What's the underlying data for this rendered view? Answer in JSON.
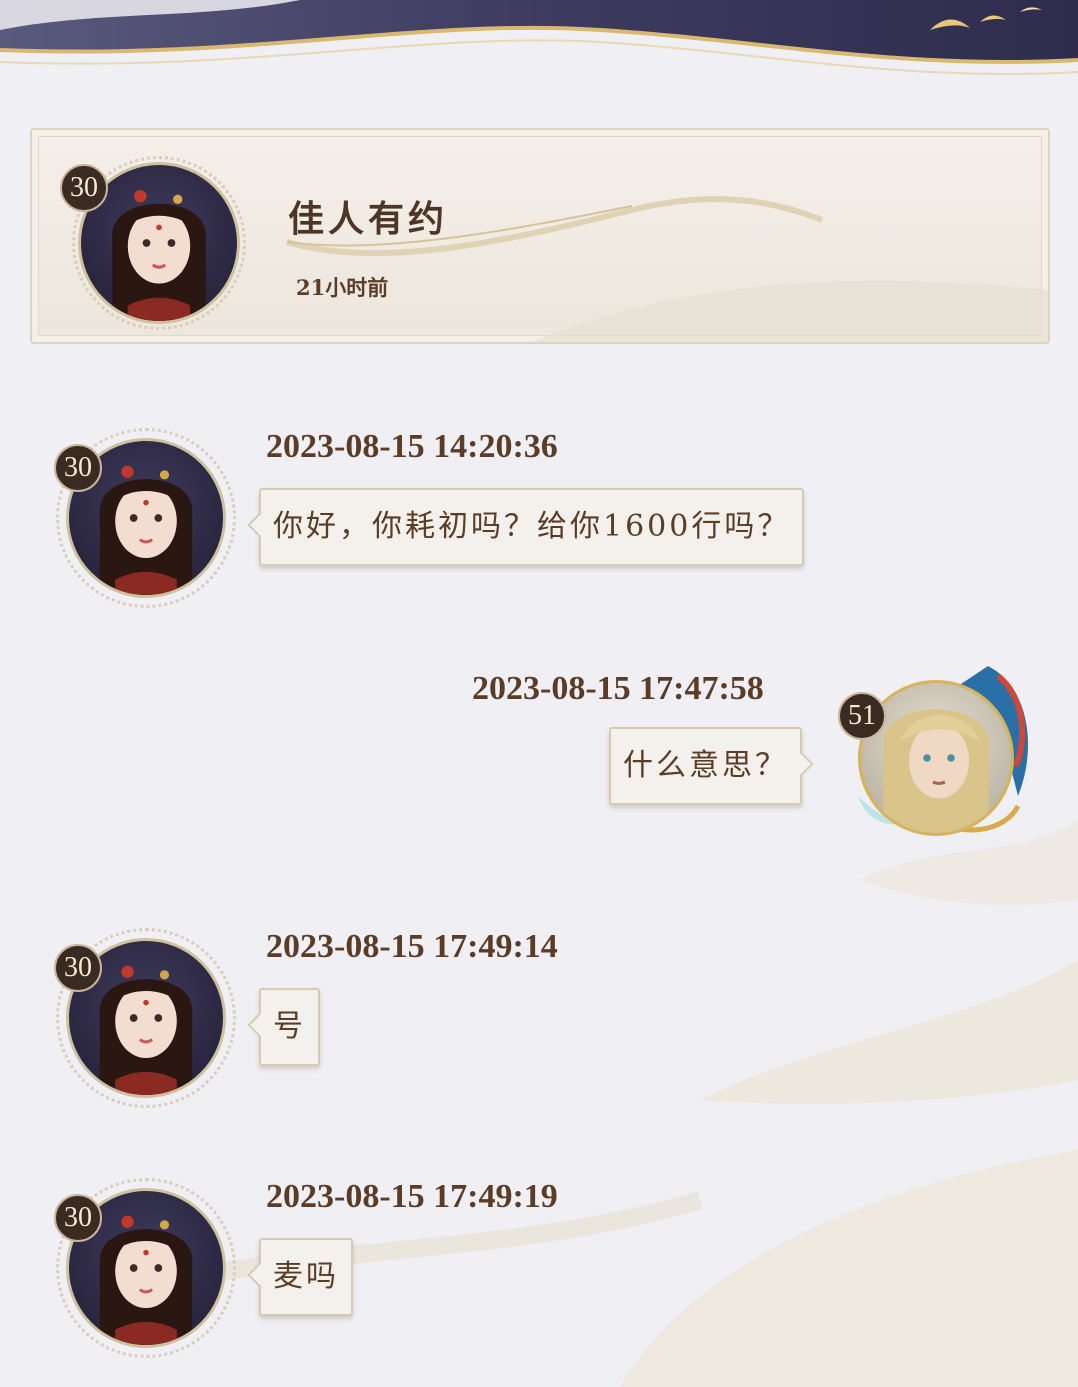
{
  "profile": {
    "name": "佳人有约",
    "last_active": "21小时前",
    "level": "30"
  },
  "messages": [
    {
      "side": "left",
      "level": "30",
      "timestamp": "2023-08-15 14:20:36",
      "text": "你好，你耗初吗？给你1600行吗？"
    },
    {
      "side": "right",
      "level": "51",
      "timestamp": "2023-08-15 17:47:58",
      "text": "什么意思？"
    },
    {
      "side": "left",
      "level": "30",
      "timestamp": "2023-08-15 17:49:14",
      "text": "号"
    },
    {
      "side": "left",
      "level": "30",
      "timestamp": "2023-08-15 17:49:19",
      "text": "麦吗"
    }
  ],
  "icons": {
    "female_avatar": "female-avatar-icon",
    "male_avatar": "male-avatar-icon",
    "birds": "birds-icon"
  },
  "colors": {
    "background": "#f0eff3",
    "text_brown": "#5a3d27",
    "bubble_bg": "#f4f1ec",
    "bubble_border": "#d7cab5",
    "badge_bg": "#3a2b22",
    "banner_navy": "#3b3a5e",
    "gold": "#d9b870"
  }
}
